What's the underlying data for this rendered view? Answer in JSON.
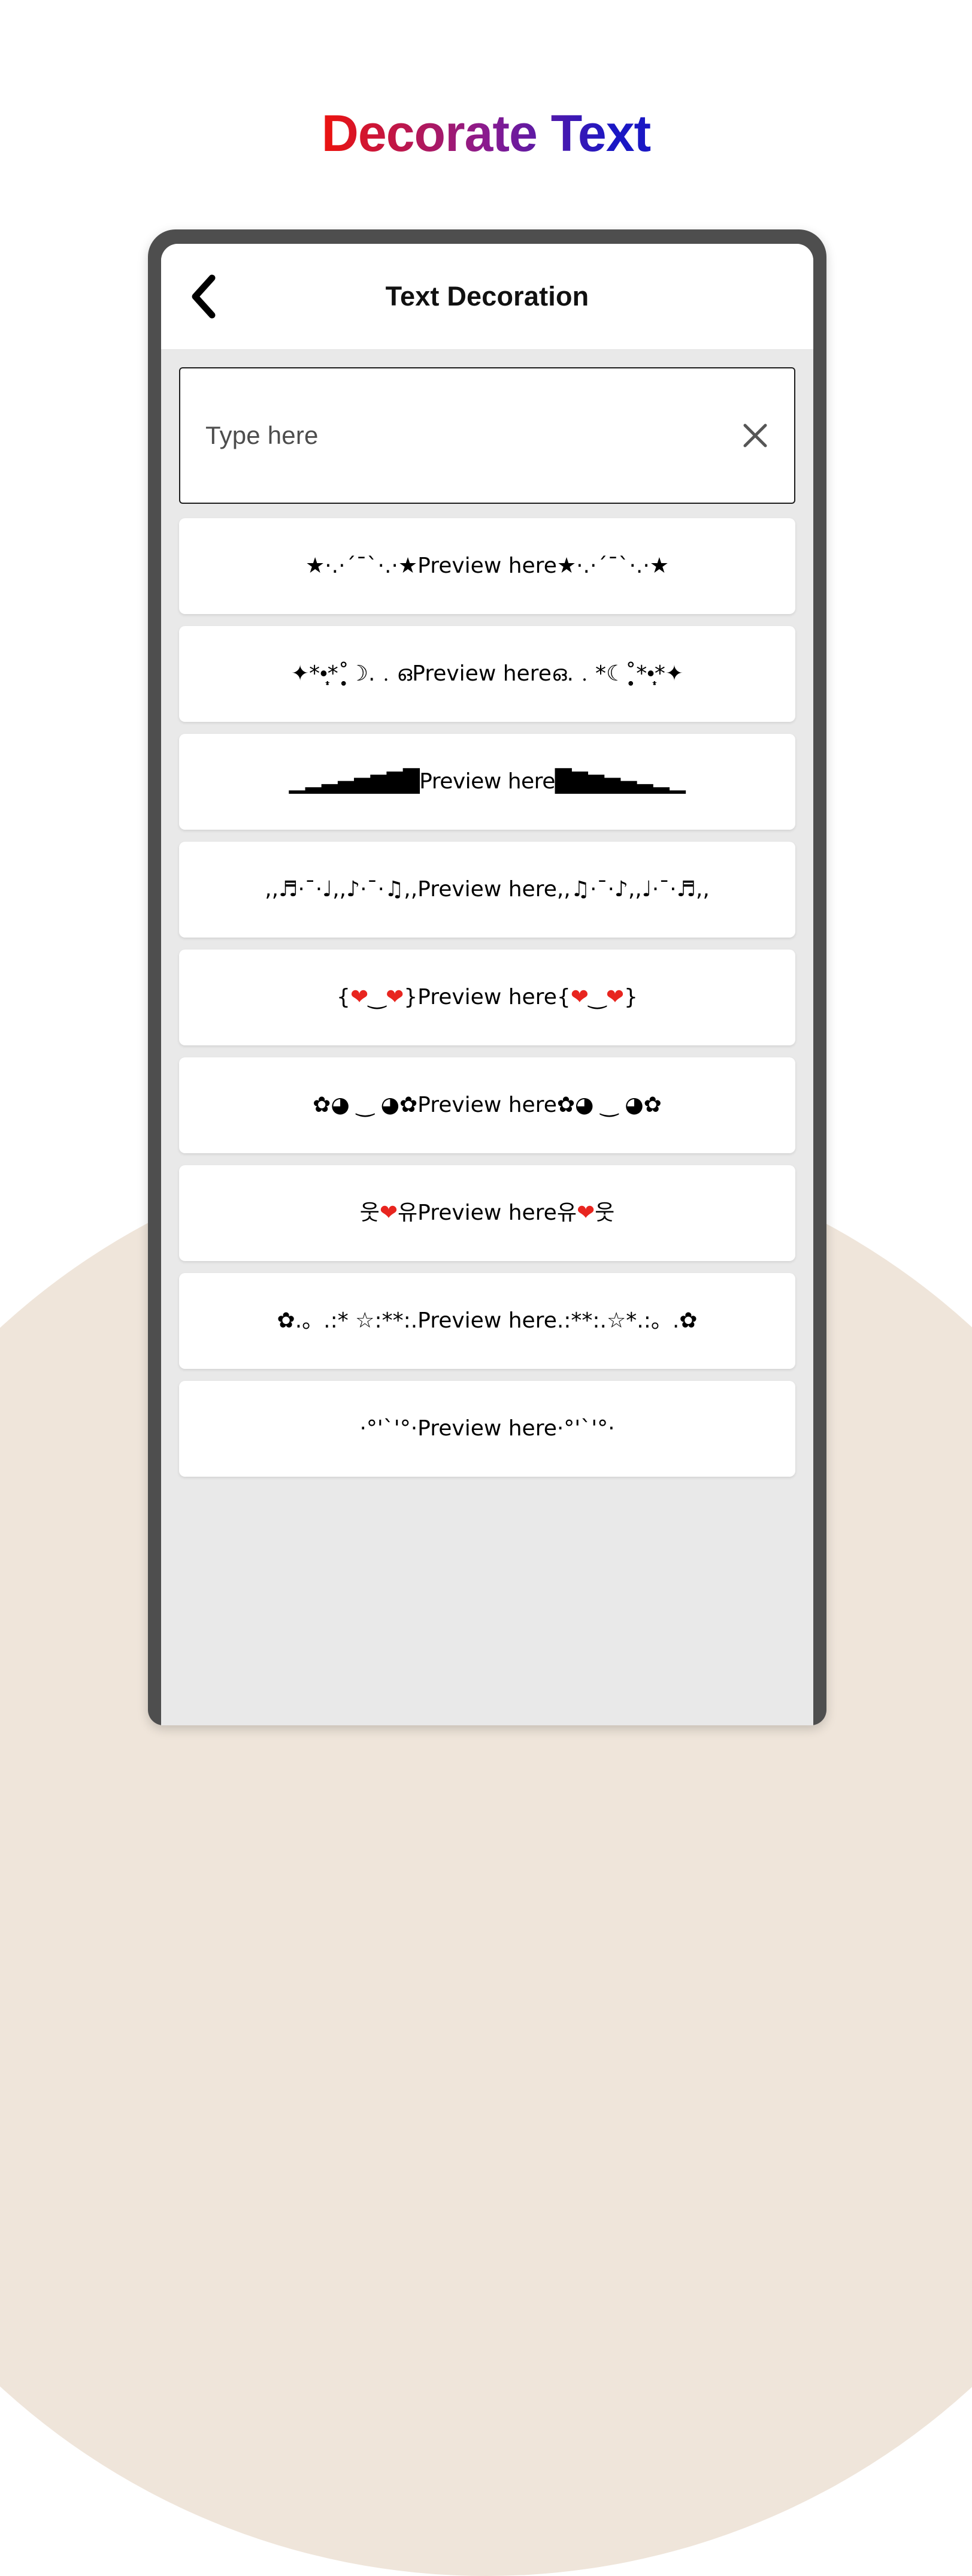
{
  "page": {
    "title": "Decorate Text",
    "title_gradient_start": "#ef1111",
    "title_gradient_end": "#1a17c4",
    "background_color": "#ffffff",
    "accent_circle_color": "#efe5da"
  },
  "device": {
    "frame_color": "#4e4e4e",
    "screen_background": "#e9e9e9"
  },
  "app": {
    "header": {
      "back_icon": "chevron-left-icon",
      "title": "Text Decoration"
    },
    "input": {
      "placeholder": "Type here",
      "value": "",
      "clear_icon": "close-icon"
    },
    "base_text": "Preview here",
    "previews": [
      {
        "id": "style-stars-sparkle",
        "prefix": "★·.·´¯`·.·★",
        "suffix": "★·.·´¯`·.·★",
        "full": "★·.·´¯`·.·★Preview here★·.·´¯`·.·★"
      },
      {
        "id": "style-diamond-moon",
        "prefix": "✦*•̩̩͙*˚̩̥̩̥☽.﹒ഒ",
        "suffix": "ഒ.﹒*☾˚̩̥̩̥*•̩̩͙*✦",
        "full": "✦*•̩̩͙*˚̩̥̩̥☽.﹒ഒPreview hereഒ.﹒*☾˚̩̥̩̥*•̩̩͙*✦"
      },
      {
        "id": "style-block-bars",
        "prefix": "▁▂▃▄▅▆▇█",
        "suffix": "█▇▆▅▄▃▂▁",
        "full": "▁▂▃▄▅▆▇█Preview here█▇▆▅▄▃▂▁"
      },
      {
        "id": "style-music-notes",
        "prefix": ",,♬·¯·♩,,♪·¯·♫,,",
        "suffix": ",,♫·¯·♪,,♩·¯·♬,,",
        "full": ",,♬·¯·♩,,♪·¯·♫,,Preview here,,♫·¯·♪,,♩·¯·♬,,"
      },
      {
        "id": "style-heart-face",
        "prefix": "{❤‿❤}",
        "suffix": "{❤‿❤}",
        "full": "{❤‿❤}Preview here{❤‿❤}"
      },
      {
        "id": "style-flower-face",
        "prefix": "✿◕ ‿ ◕✿",
        "suffix": "✿◕ ‿ ◕✿",
        "full": "✿◕ ‿ ◕✿Preview here✿◕ ‿ ◕✿"
      },
      {
        "id": "style-korean-heart",
        "prefix": "웃❤유",
        "suffix": "유❤웃",
        "full": "웃❤유Preview here유❤웃"
      },
      {
        "id": "style-flower-star",
        "prefix": "✿.。.:* ☆:**:.",
        "suffix": ".:**:.☆*.:。.✿",
        "full": "✿.。.:* ☆:**:.Preview here.:**:.☆*.:。.✿"
      },
      {
        "id": "style-partial-row",
        "prefix": "·°'`'°·",
        "suffix": "·°'`'°·",
        "full": "·°'`'°·Preview here·°'`'°·"
      }
    ]
  }
}
